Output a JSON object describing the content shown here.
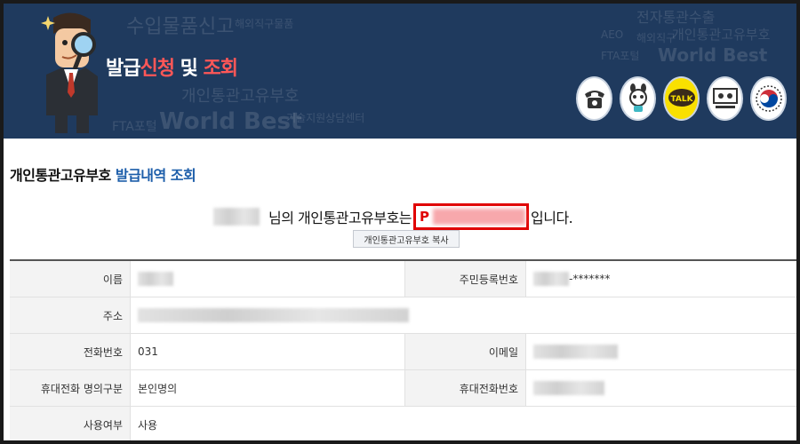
{
  "banner": {
    "title_part1": "발급",
    "title_part2": "신청",
    "title_part3": " 및 ",
    "title_part4": "조회",
    "bg_words": [
      "수입물품신고",
      "해외직구물품",
      "개인통관고유부호",
      "FTA포털",
      "World Best",
      "기술지원상담센터",
      "전자통관수출",
      "AEO",
      "해외직구",
      "개인통관고유부호",
      "FTA포털",
      "World Best"
    ],
    "icons": [
      "phone-icon",
      "chatbot-icon",
      "talk-icon",
      "video-consult-icon",
      "korea-emblem-icon"
    ],
    "talk_label": "TALK"
  },
  "section": {
    "title_part1": "개인통관고유부호 ",
    "title_part2": "발급내역 조회"
  },
  "result": {
    "prefix": "님의 개인통관고유부호는",
    "code_prefix": "P",
    "suffix": "입니다."
  },
  "copy_button": "개인통관고유부호 복사",
  "table": {
    "name_label": "이름",
    "rrn_label": "주민등록번호",
    "rrn_masked": "-*******",
    "address_label": "주소",
    "phone_label": "전화번호",
    "phone_value": "031",
    "email_label": "이메일",
    "mobile_owner_label": "휴대전화 명의구분",
    "mobile_owner_value": "본인명의",
    "mobile_label": "휴대전화번호",
    "usage_label": "사용여부",
    "usage_value": "사용"
  },
  "colors": {
    "banner_bg": "#1f3a5e",
    "title_accent": "#ff5757",
    "section_blue": "#1d5eaa",
    "highlight_red": "#e00000"
  }
}
